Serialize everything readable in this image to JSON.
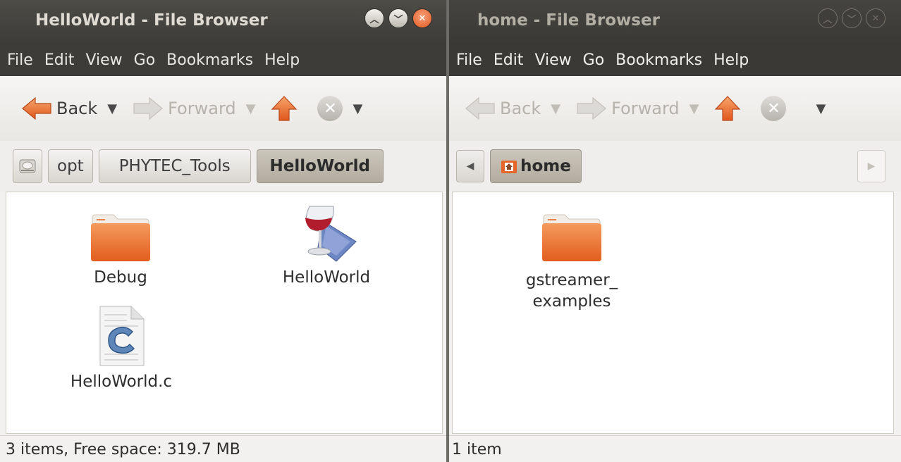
{
  "left_window": {
    "title": "HelloWorld - File Browser",
    "menu": [
      "File",
      "Edit",
      "View",
      "Go",
      "Bookmarks",
      "Help"
    ],
    "toolbar": {
      "back": "Back",
      "forward": "Forward"
    },
    "breadcrumb": [
      "opt",
      "PHYTEC_Tools",
      "HelloWorld"
    ],
    "files": [
      {
        "name": "Debug",
        "icon": "folder-icon"
      },
      {
        "name": "HelloWorld",
        "icon": "wine-executable-icon"
      },
      {
        "name": "HelloWorld.c",
        "icon": "c-source-file-icon"
      }
    ],
    "status": "3 items, Free space: 319.7 MB"
  },
  "right_window": {
    "title": "home - File Browser",
    "menu": [
      "File",
      "Edit",
      "View",
      "Go",
      "Bookmarks",
      "Help"
    ],
    "toolbar": {
      "back": "Back",
      "forward": "Forward"
    },
    "breadcrumb": [
      "home"
    ],
    "files": [
      {
        "name_lines": [
          "gstreamer_",
          "examples"
        ],
        "icon": "folder-icon"
      }
    ],
    "status": "1 item"
  },
  "colors": {
    "accent_orange": "#e86a2a",
    "titlebar": "#3d3c38",
    "toolbar": "#efeeec"
  }
}
